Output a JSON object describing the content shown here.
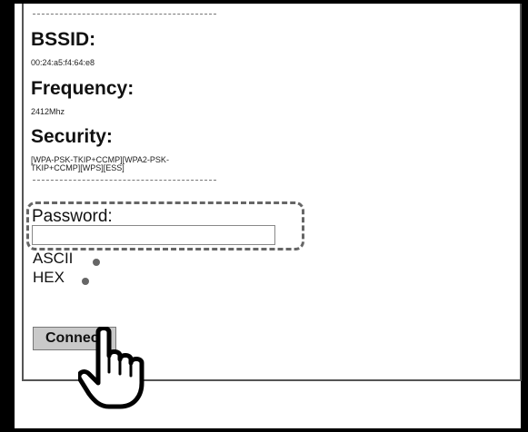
{
  "network": {
    "bssid_label": "BSSID:",
    "bssid_value": "00:24:a5:f4:64:e8",
    "frequency_label": "Frequency:",
    "frequency_value": "2412Mhz",
    "security_label": "Security:",
    "security_value_line1": "[WPA-PSK-TKIP+CCMP][WPA2-PSK-",
    "security_value_line2": "TKIP+CCMP][WPS][ESS]"
  },
  "password": {
    "label": "Password:",
    "value": "",
    "encoding_options": [
      "ASCII",
      "HEX"
    ]
  },
  "connect_label": "Connect",
  "icons": {
    "pointer": "hand-pointer-icon"
  }
}
